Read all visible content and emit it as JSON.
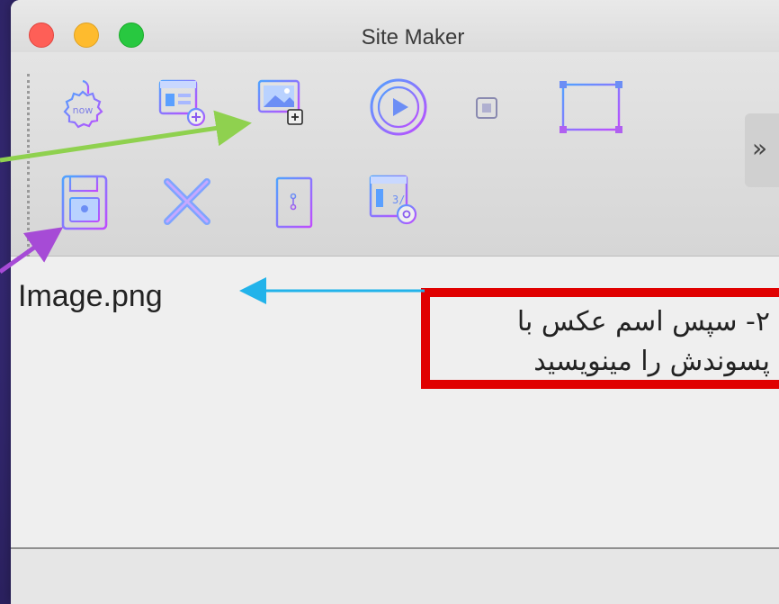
{
  "window": {
    "title": "Site Maker"
  },
  "toolbar": {
    "row1": [
      {
        "icon": "now-badge-icon"
      },
      {
        "icon": "add-page-icon"
      },
      {
        "icon": "add-image-icon"
      },
      {
        "icon": "play-video-icon"
      },
      {
        "icon": "stop-square-icon"
      },
      {
        "icon": "selection-rectangle-icon"
      }
    ],
    "row2": [
      {
        "icon": "save-floppy-icon"
      },
      {
        "icon": "delete-x-icon"
      },
      {
        "icon": "door-icon"
      },
      {
        "icon": "view-source-icon"
      }
    ],
    "overflow_label": "»"
  },
  "editor": {
    "filename": "Image.png"
  },
  "annotation": {
    "line1": "۲- سپس اسم عکس با",
    "line2": "پسوندش را مینویسید"
  },
  "colors": {
    "annotation_border": "#e00000",
    "arrow_green": "#8fd14f",
    "arrow_purple": "#a64bd6",
    "arrow_blue": "#22b3ea",
    "icon_gradient_start": "#4fa3ff",
    "icon_gradient_end": "#c04bff"
  }
}
